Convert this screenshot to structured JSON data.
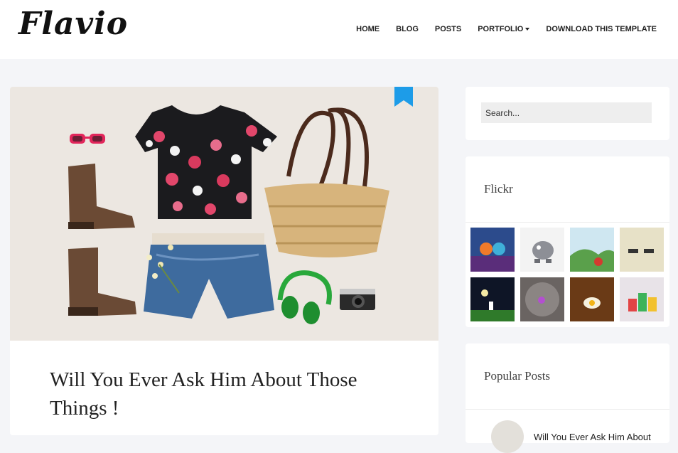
{
  "header": {
    "logo": "Flavio",
    "nav": [
      {
        "label": "HOME"
      },
      {
        "label": "BLOG"
      },
      {
        "label": "POSTS"
      },
      {
        "label": "PORTFOLIO",
        "has_dropdown": true
      },
      {
        "label": "DOWNLOAD THIS TEMPLATE"
      }
    ]
  },
  "post": {
    "title": "Will You Ever Ask Him About Those Things !",
    "bookmark_icon": "bookmark-icon",
    "accent_color": "#1d9ce8"
  },
  "sidebar": {
    "search": {
      "placeholder": "Search..."
    },
    "flickr": {
      "title": "Flickr",
      "photo_count": 8
    },
    "popular_posts": {
      "title": "Popular Posts",
      "items": [
        {
          "label": "Will You Ever Ask Him About"
        }
      ]
    }
  }
}
